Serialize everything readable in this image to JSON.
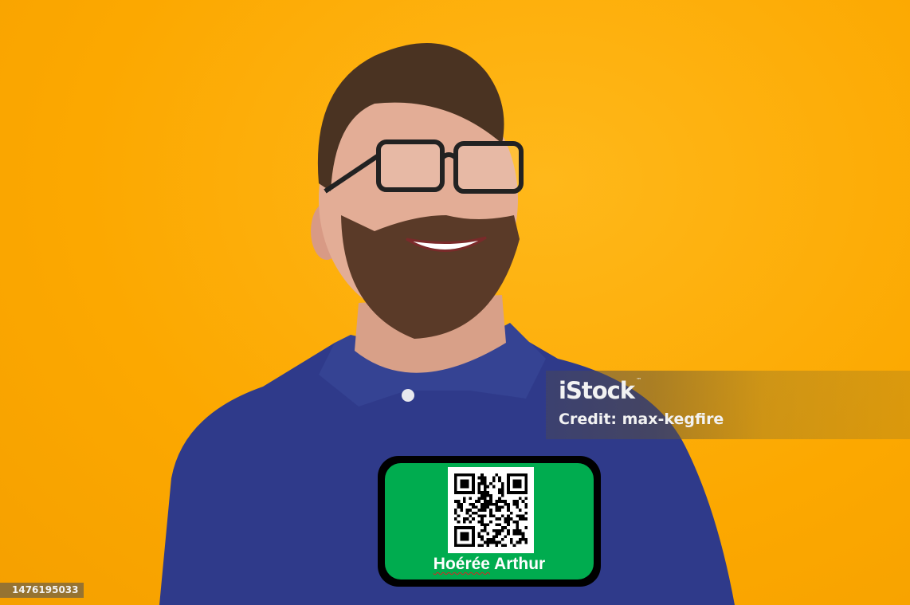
{
  "photo": {
    "subject": "smiling bearded man with glasses in navy polo shirt",
    "background_color": "#fca800",
    "shirt_color": "#2f3a8a"
  },
  "watermark": {
    "brand": "iStock",
    "trademark": "™",
    "credit": "Credit: max-kegfire"
  },
  "image_id": "1476195033",
  "badge": {
    "first": "Hoérée",
    "last": "Arthur",
    "color": "#00ac4f",
    "qr_icon": "qr-code"
  }
}
